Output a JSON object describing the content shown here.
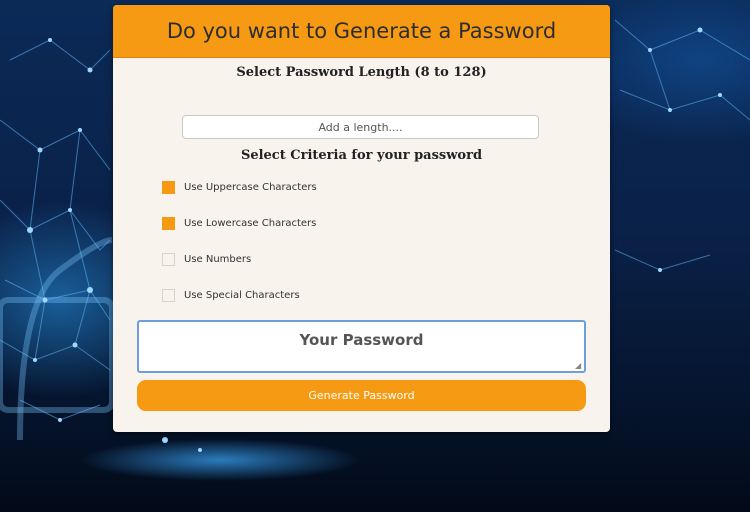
{
  "header": {
    "title": "Do you want to Generate a Password"
  },
  "length": {
    "heading": "Select Password Length (8 to 128)",
    "placeholder": "Add a length....",
    "value": ""
  },
  "criteria": {
    "heading": "Select Criteria for your password",
    "options": [
      {
        "label": "Use Uppercase Characters",
        "checked": true
      },
      {
        "label": "Use Lowercase Characters",
        "checked": true
      },
      {
        "label": "Use Numbers",
        "checked": false
      },
      {
        "label": "Use Special Characters",
        "checked": false
      }
    ]
  },
  "output": {
    "placeholder": "Your Password",
    "value": ""
  },
  "actions": {
    "generate_label": "Generate Password"
  },
  "colors": {
    "accent": "#f79a13",
    "card_background": "#f8f3ec",
    "textarea_border": "#6f9fd8"
  }
}
